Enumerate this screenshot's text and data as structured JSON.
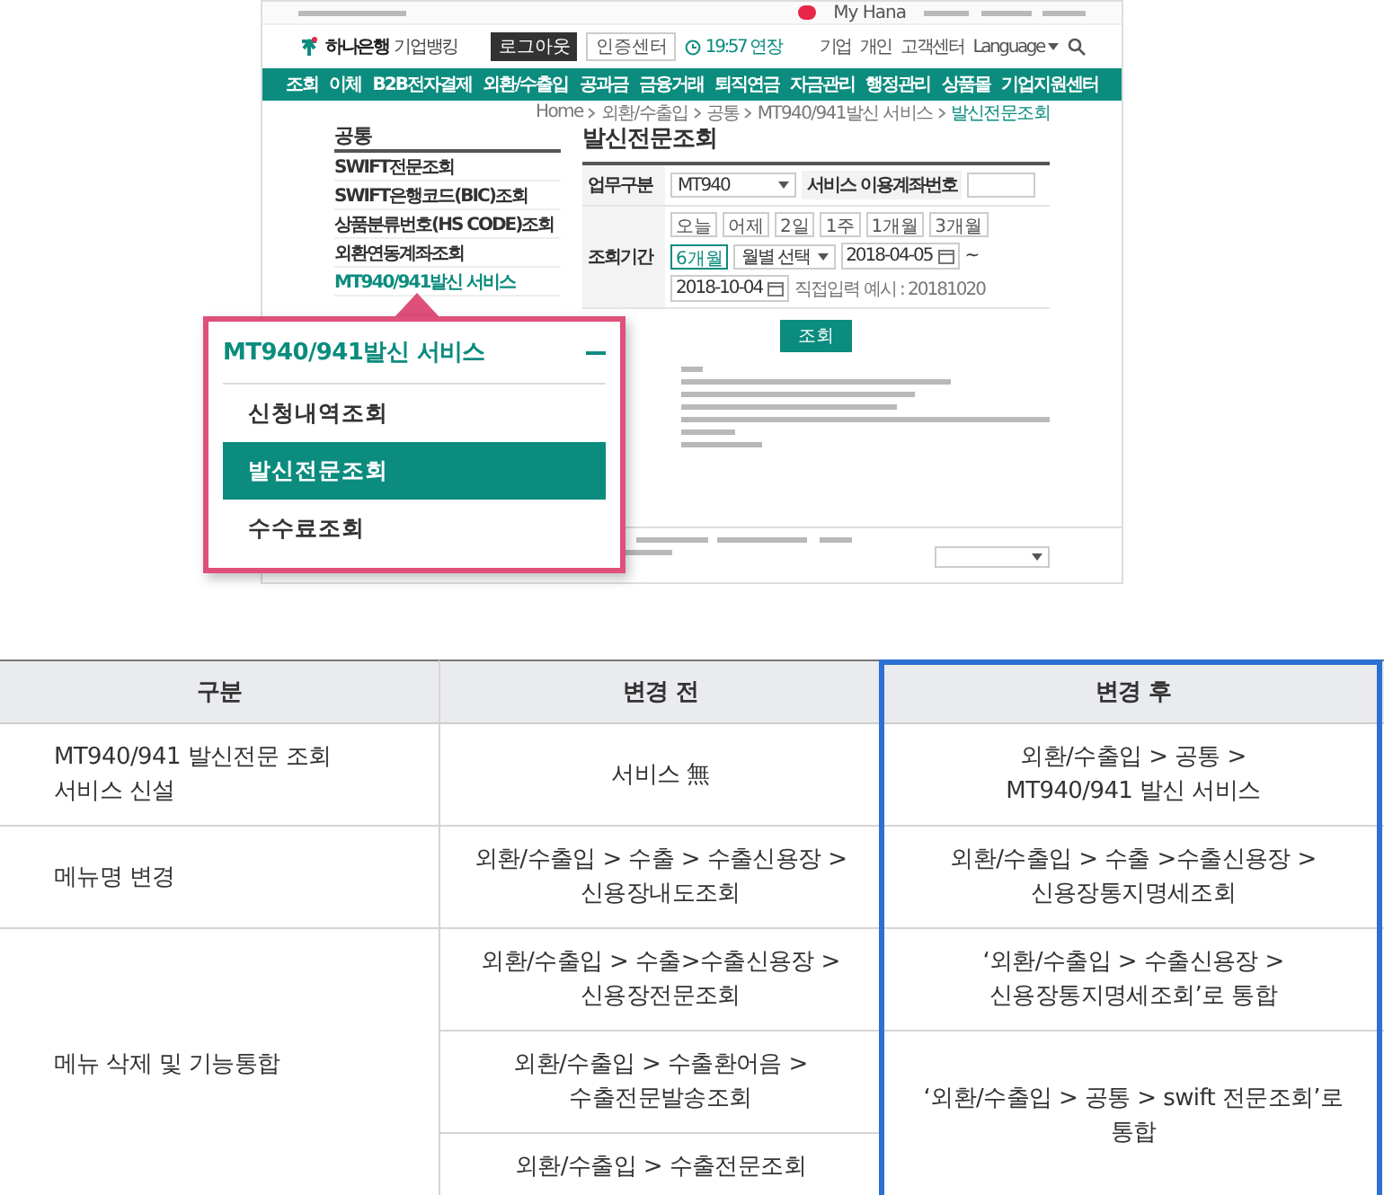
{
  "website": {
    "top_bar": {
      "links": [
        "My Hana"
      ]
    },
    "header": {
      "logo_name": "하나은행",
      "logo_sub": "기업뱅킹",
      "buttons": [
        "로그아웃",
        "인증센터"
      ],
      "timer": "19:57 연장",
      "links": [
        "기업",
        "개인",
        "고객센터"
      ],
      "language": "Language"
    },
    "nav": [
      "조회",
      "이체",
      "B2B전자결제",
      "외환/수출입",
      "공과금",
      "금융거래",
      "퇴직연금",
      "자금관리",
      "행정관리",
      "상품몰",
      "기업지원센터"
    ],
    "breadcrumb": [
      "Home",
      "외환/수출입",
      "공통",
      "MT940/941발신 서비스",
      "발신전문조회"
    ],
    "sidebar": {
      "title": "공통",
      "items": [
        {
          "label": "SWIFT전문조회",
          "selected": false
        },
        {
          "label": "SWIFT은행코드(BIC)조회",
          "selected": false
        },
        {
          "label": "상품분류번호(HS CODE)조회",
          "selected": false
        },
        {
          "label": "외환연동계좌조회",
          "selected": false
        },
        {
          "label": "MT940/941발신 서비스",
          "selected": true
        }
      ]
    },
    "page_title": "발신전문조회",
    "form": {
      "type_label": "업무구분",
      "type_value": "MT940",
      "account_label": "서비스 이용계좌번호",
      "period_label": "조회기간",
      "period_buttons": [
        {
          "label": "오늘",
          "selected": false
        },
        {
          "label": "어제",
          "selected": false
        },
        {
          "label": "2일",
          "selected": false
        },
        {
          "label": "1주",
          "selected": false
        },
        {
          "label": "1개월",
          "selected": false
        },
        {
          "label": "3개월",
          "selected": false
        },
        {
          "label": "6개월",
          "selected": true
        }
      ],
      "month_select": "월별 선택",
      "date_from": "2018-04-05",
      "date_separator": "~",
      "date_to": "2018-10-04",
      "date_hint": "직접입력 예시 : 20181020"
    },
    "search_button": "조회"
  },
  "callout": {
    "title": "MT940/941발신 서비스",
    "expanded": true,
    "items": [
      {
        "label": "신청내역조회",
        "selected": false
      },
      {
        "label": "발신전문조회",
        "selected": true
      },
      {
        "label": "수수료조회",
        "selected": false
      }
    ]
  },
  "table": {
    "columns": [
      "구분",
      "변경 전",
      "변경 후"
    ],
    "rows": [
      {
        "category": "MT940/941 발신전문 조회\n서비스 신설",
        "groups": [
          {
            "before": [
              "서비스 無"
            ],
            "after": "외환/수출입 >  공통 >\nMT940/941 발신 서비스"
          }
        ]
      },
      {
        "category": "메뉴명 변경",
        "groups": [
          {
            "before": [
              "외환/수출입 > 수출 > 수출신용장 >\n신용장내도조회"
            ],
            "after": "외환/수출입 > 수출 >수출신용장 >\n신용장통지명세조회"
          }
        ]
      },
      {
        "category": "메뉴 삭제 및 기능통합",
        "groups": [
          {
            "before": [
              "외환/수출입 > 수출>수출신용장 >\n신용장전문조회"
            ],
            "after": "‘외환/수출입 > 수출신용장 >\n신용장통지명세조회’로 통합"
          },
          {
            "before": [
              "외환/수출입 > 수출환어음 >\n수출전문발송조회",
              "외환/수출입 > 수출전문조회"
            ],
            "after": "‘외환/수출입 > 공통 > swift 전문조회’로\n통합"
          }
        ]
      }
    ]
  }
}
